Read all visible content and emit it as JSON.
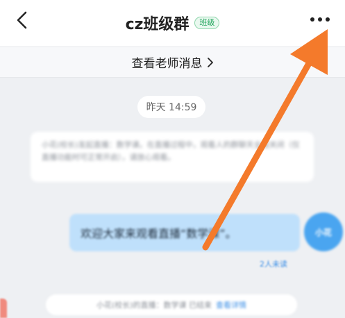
{
  "header": {
    "title": "cz班级群",
    "badge": "班级"
  },
  "teacher_bar": {
    "label": "查看老师消息"
  },
  "chat": {
    "timestamp": "昨天 14:59",
    "system_message": "小花(校长)发起直播：数学课。在直播过程中，观看人的群聊天全程关闭（仅直播功能时可正常开启），请放心观看。",
    "live_message": "欢迎大家来观看直播“数学课”。",
    "avatar_text": "小花",
    "read_status": "2人未读",
    "bottom_notice": "小花(校长)的直播：数学课 已结束",
    "bottom_link": "查看详情"
  },
  "colors": {
    "bubble": "#bfe0fb",
    "arrow": "#f47a2b",
    "badge_green": "#1fa35a"
  }
}
